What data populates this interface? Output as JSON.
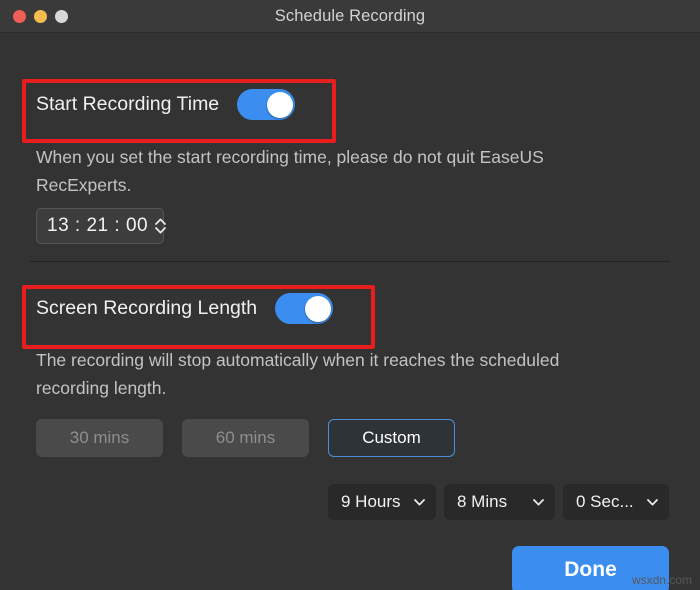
{
  "window": {
    "title": "Schedule Recording",
    "traffic_lights": [
      {
        "name": "close",
        "color": "#ef5f56"
      },
      {
        "name": "minimize",
        "color": "#f5bd4f"
      },
      {
        "name": "zoom",
        "color": "#d8d8d8"
      }
    ]
  },
  "start_recording": {
    "label": "Start Recording Time",
    "toggle_state": "on",
    "helper_text": "When you set the start recording time, please do not quit EaseUS RecExperts.",
    "time_value": "13 : 21 : 00",
    "time_hours": "13",
    "time_minutes": "21",
    "time_seconds": "00",
    "stepper_up_icon": "chevron-up-icon",
    "stepper_down_icon": "chevron-down-icon"
  },
  "recording_length": {
    "label": "Screen Recording Length",
    "toggle_state": "on",
    "helper_text": "The recording will stop automatically when it reaches the scheduled recording length.",
    "presets": [
      {
        "label": "30 mins",
        "state": "disabled"
      },
      {
        "label": "60 mins",
        "state": "disabled"
      },
      {
        "label": "Custom",
        "state": "selected"
      }
    ],
    "duration_selects": [
      {
        "name": "hours",
        "value": "9 Hours",
        "icon": "chevron-down-icon"
      },
      {
        "name": "minutes",
        "value": "8 Mins",
        "icon": "chevron-down-icon"
      },
      {
        "name": "seconds",
        "value": "0 Sec...",
        "icon": "chevron-down-icon"
      }
    ]
  },
  "footer": {
    "done_label": "Done"
  },
  "watermark": "wsxdn.com",
  "colors": {
    "window_bg": "#333333",
    "titlebar_bg": "#3a3a3a",
    "accent_blue": "#3b8ef0",
    "annotation_red": "#e81e1e",
    "selected_border": "#4a90d9",
    "text_primary": "#f0f0f0",
    "text_secondary": "#c3c3c3",
    "text_disabled": "#8e8e8e"
  }
}
